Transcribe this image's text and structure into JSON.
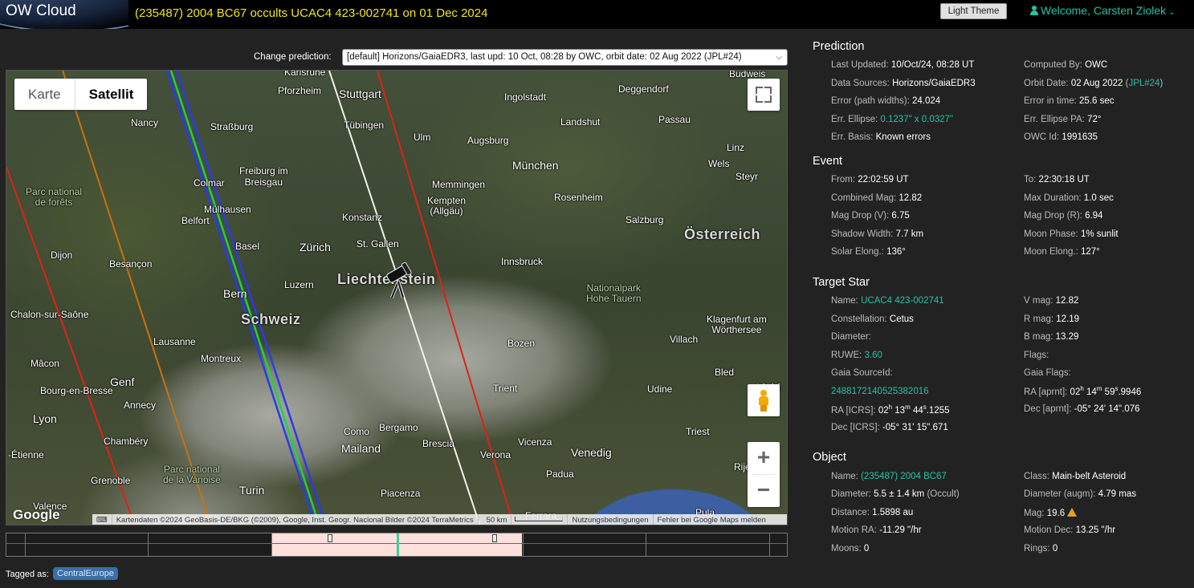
{
  "header": {
    "logo": "OW Cloud",
    "title": "(235487) 2004 BC67 occults UCAC4 423-002741 on 01 Dec 2024",
    "theme_button": "Light Theme",
    "welcome": "Welcome, Carsten Ziolek"
  },
  "prediction_select": {
    "label": "Change prediction:",
    "value": "[default] Horizons/GaiaEDR3, last upd: 10 Oct, 08:28 by OWC, orbit date: 02 Aug 2022 (JPL#24)"
  },
  "map": {
    "type_buttons": [
      "Karte",
      "Satellit"
    ],
    "active_type": "Satellit",
    "google": "Google",
    "attribution": "Kartendaten ©2024 GeoBasis-DE/BKG (©2009), Google, Inst. Geogr. Nacional Bilder ©2024 TerraMetrics",
    "scale": "50 km",
    "terms": "Nutzungsbedingungen",
    "report": "Fehler bei Google Maps melden",
    "zoom_in": "+",
    "zoom_out": "−",
    "labels": {
      "karlsruhe": "Karlsruhe",
      "budweis": "Budweis",
      "pforzheim": "Pforzheim",
      "stuttgart": "Stuttgart",
      "ingolstadt": "Ingolstadt",
      "deggendorf": "Deggendorf",
      "nancy": "Nancy",
      "strassburg": "Straßburg",
      "tuebingen": "Tübingen",
      "landshut": "Landshut",
      "passau": "Passau",
      "ulm": "Ulm",
      "augsburg": "Augsburg",
      "linz": "Linz",
      "freiburg": "Freiburg im\nBreisgau",
      "wels": "Wels",
      "steyr": "Steyr",
      "parc_forets": "Parc national\nde forêts",
      "colmar": "Colmar",
      "memmingen": "Memmingen",
      "muenchen": "München",
      "kempten": "Kempten\n(Allgäu)",
      "rosenheim": "Rosenheim",
      "belfort": "Belfort",
      "muelhausen": "Mülhausen",
      "konstanz": "Konstanz",
      "salzburg": "Salzburg",
      "basel": "Basel",
      "oesterreich": "Österreich",
      "dijon": "Dijon",
      "besancon": "Besançon",
      "zuerich": "Zürich",
      "st_gallen": "St. Gallen",
      "innsbruck": "Innsbruck",
      "liechtenstein": "Liechtenstein",
      "luzern": "Luzern",
      "np_hohe_tauern": "Nationalpark\nHohe Tauern",
      "chalon": "Chalon-sur-Saône",
      "bern": "Bern",
      "schweiz": "Schweiz",
      "klagenfurt": "Klagenfurt am\nWörthersee",
      "villach": "Villach",
      "lausanne": "Lausanne",
      "bozen": "Bozen",
      "montreux": "Montreux",
      "macon": "Mâcon",
      "bled": "Bled",
      "genf": "Genf",
      "bourg": "Bourg-en-Bresse",
      "trient": "Trient",
      "udine": "Udine",
      "ljubljana": "Ljubl",
      "annecy": "Annecy",
      "lyon": "Lyon",
      "como": "Como",
      "bergamo": "Bergamo",
      "triest": "Triest",
      "chambery": "Chambéry",
      "brescia": "Brescia",
      "vicenza": "Vicenza",
      "mailand": "Mailand",
      "venedig": "Venedig",
      "etienne": "-Étienne",
      "verona": "Verona",
      "padua": "Padua",
      "rije": "Rije",
      "grenoble": "Grenoble",
      "parc_vanoise": "Parc national\nde la Vanoise",
      "turin": "Turin",
      "piacenza": "Piacenza",
      "valence": "Valence",
      "ferrara": "Ferrara",
      "pula": "Pula"
    }
  },
  "timeline": {
    "event_window_fraction": [
      0.339,
      0.66
    ],
    "marker_fraction": 0.5
  },
  "tags": {
    "label": "Tagged as:",
    "items": [
      "CentralEurope"
    ]
  },
  "prediction": {
    "title": "Prediction",
    "last_updated_k": "Last Updated:",
    "last_updated_v": "10/Oct/24, 08:28 UT",
    "computed_by_k": "Computed By:",
    "computed_by_v": "OWC",
    "data_sources_k": "Data Sources:",
    "data_sources_v": "Horizons/GaiaEDR3",
    "orbit_date_k": "Orbit Date:",
    "orbit_date_v": "02 Aug 2022",
    "orbit_date_jpl": "JPL#24",
    "error_paths_k": "Error (path widths):",
    "error_paths_v": "24.024",
    "error_time_k": "Error in time:",
    "error_time_v": "25.6 sec",
    "err_ellipse_k": "Err. Ellipse:",
    "err_ellipse_v": "0.1237\" x 0.0327\"",
    "err_ellipse_pa_k": "Err. Ellipse PA:",
    "err_ellipse_pa_v": "72°",
    "err_basis_k": "Err. Basis:",
    "err_basis_v": "Known errors",
    "owc_id_k": "OWC Id:",
    "owc_id_v": "1991635"
  },
  "event": {
    "title": "Event",
    "from_k": "From:",
    "from_v": "22:02:59 UT",
    "to_k": "To:",
    "to_v": "22:30:18 UT",
    "combined_mag_k": "Combined Mag:",
    "combined_mag_v": "12.82",
    "max_duration_k": "Max Duration:",
    "max_duration_v": "1.0 sec",
    "mag_drop_v_k": "Mag Drop (V):",
    "mag_drop_v_v": "6.75",
    "mag_drop_r_k": "Mag Drop (R):",
    "mag_drop_r_v": "6.94",
    "shadow_width_k": "Shadow Width:",
    "shadow_width_v": "7.7 km",
    "moon_phase_k": "Moon Phase:",
    "moon_phase_v": "1% sunlit",
    "solar_elong_k": "Solar Elong.:",
    "solar_elong_v": "136°",
    "moon_elong_k": "Moon Elong.:",
    "moon_elong_v": "127°"
  },
  "target_star": {
    "title": "Target Star",
    "name_k": "Name:",
    "name_v": "UCAC4 423-002741",
    "vmag_k": "V mag:",
    "vmag_v": "12.82",
    "constellation_k": "Constellation:",
    "constellation_v": "Cetus",
    "rmag_k": "R mag:",
    "rmag_v": "12.19",
    "diameter_k": "Diameter:",
    "bmag_k": "B mag:",
    "bmag_v": "13.29",
    "ruwe_k": "RUWE:",
    "ruwe_v": "3.60",
    "flags_k": "Flags:",
    "gaia_source_k": "Gaia SourceId:",
    "gaia_source_v": "2488172140525382016",
    "gaia_flags_k": "Gaia Flags:",
    "ra_aprnt_k": "RA [aprnt]:",
    "ra_aprnt_h": "02",
    "ra_aprnt_m": "14",
    "ra_aprnt_s": "59",
    "ra_aprnt_frac": ".9946",
    "ra_icrs_k": "RA [ICRS]:",
    "ra_icrs_h": "02",
    "ra_icrs_m": "13",
    "ra_icrs_s": "44",
    "ra_icrs_frac": ".1255",
    "dec_aprnt_k": "Dec [aprnt]:",
    "dec_aprnt_v": "-05° 24' 14\".076",
    "dec_icrs_k": "Dec [ICRS]:",
    "dec_icrs_v": "-05° 31' 15\".671"
  },
  "object": {
    "title": "Object",
    "name_k": "Name:",
    "name_v": "(235487) 2004 BC67",
    "class_k": "Class:",
    "class_v": "Main-belt Asteroid",
    "diameter_k": "Diameter:",
    "diameter_v": "5.5 ± 1.4 km",
    "diameter_src": "(Occult)",
    "diameter_augm_k": "Diameter (augm):",
    "diameter_augm_v": "4.79 mas",
    "distance_k": "Distance:",
    "distance_v": "1.5898 au",
    "mag_k": "Mag:",
    "mag_v": "19.6",
    "motion_ra_k": "Motion RA:",
    "motion_ra_v": "-11.29 \"/hr",
    "motion_dec_k": "Motion Dec:",
    "motion_dec_v": "13.25 \"/hr",
    "moons_k": "Moons:",
    "moons_v": "0",
    "rings_k": "Rings:",
    "rings_v": "0"
  }
}
